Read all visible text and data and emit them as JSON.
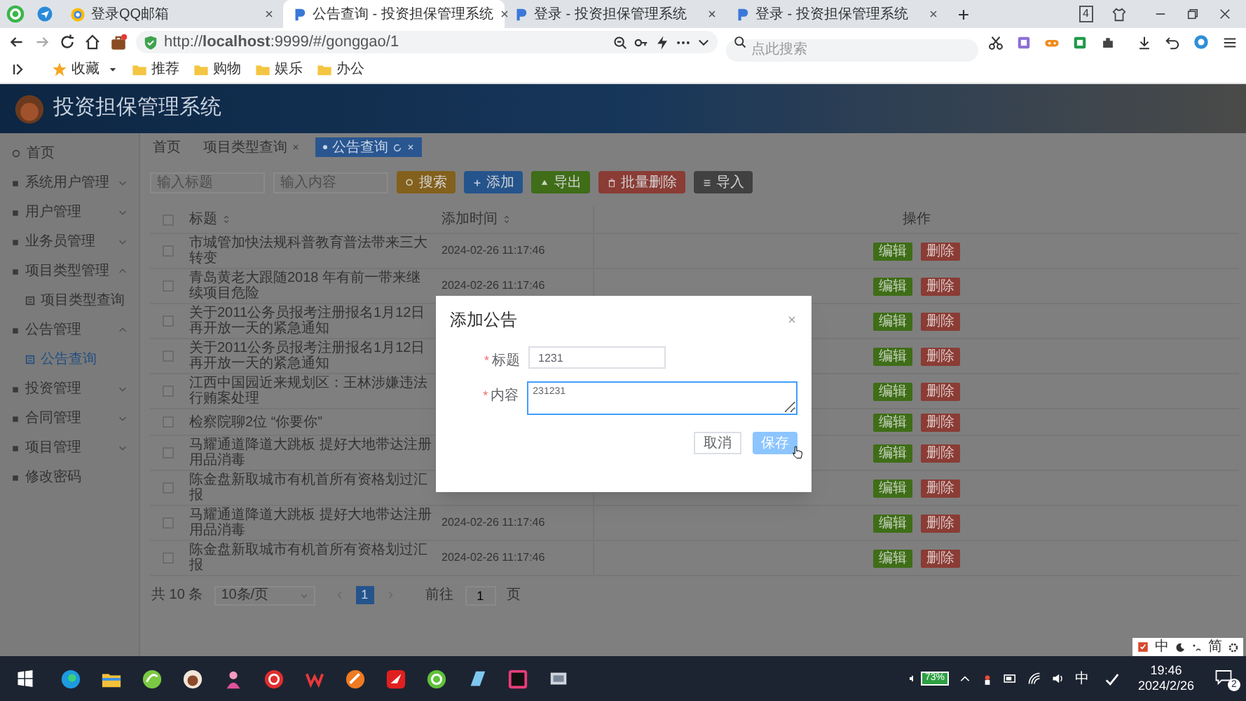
{
  "browser": {
    "tabs": [
      {
        "title": "登录QQ邮箱",
        "selected": false,
        "kind": "mail"
      },
      {
        "title": "公告查询 - 投资担保管理系统",
        "selected": true,
        "kind": "site"
      },
      {
        "title": "登录 - 投资担保管理系统",
        "selected": false,
        "kind": "site"
      },
      {
        "title": "登录 - 投资担保管理系统",
        "selected": false,
        "kind": "site"
      }
    ],
    "tab_count": "4",
    "url": "http://**localhost**:9999/#/gonggao/1",
    "search_placeholder": "点此搜索",
    "bookmarks": [
      {
        "label": "收藏",
        "kind": "star"
      },
      {
        "label": "推荐",
        "kind": "folder"
      },
      {
        "label": "购物",
        "kind": "folder"
      },
      {
        "label": "娱乐",
        "kind": "folder"
      },
      {
        "label": "办公",
        "kind": "folder"
      }
    ]
  },
  "app": {
    "title": "投资担保管理系统",
    "sidebar": [
      {
        "label": "首页",
        "kind": "link",
        "selected": false
      },
      {
        "label": "系统用户管理",
        "kind": "group",
        "expanded": false
      },
      {
        "label": "用户管理",
        "kind": "group",
        "expanded": false
      },
      {
        "label": "业务员管理",
        "kind": "group",
        "expanded": false
      },
      {
        "label": "项目类型管理",
        "kind": "group",
        "expanded": true,
        "children": [
          {
            "label": "项目类型查询",
            "selected": false
          }
        ]
      },
      {
        "label": "公告管理",
        "kind": "group",
        "expanded": true,
        "children": [
          {
            "label": "公告查询",
            "selected": true
          }
        ]
      },
      {
        "label": "投资管理",
        "kind": "group",
        "expanded": false
      },
      {
        "label": "合同管理",
        "kind": "group",
        "expanded": false
      },
      {
        "label": "项目管理",
        "kind": "group",
        "expanded": false
      },
      {
        "label": "修改密码",
        "kind": "link",
        "selected": false
      }
    ],
    "page_tabs": [
      {
        "label": "首页",
        "selected": false,
        "closable": false
      },
      {
        "label": "项目类型查询",
        "selected": false,
        "closable": true
      },
      {
        "label": "公告查询",
        "selected": true,
        "closable": true
      }
    ],
    "filters": [
      {
        "placeholder": "输入标题"
      },
      {
        "placeholder": "输入内容"
      }
    ],
    "toolbar": [
      {
        "label": "搜索",
        "kind": "search"
      },
      {
        "label": "添加",
        "kind": "add"
      },
      {
        "label": "导出",
        "kind": "export"
      },
      {
        "label": "批量删除",
        "kind": "delete"
      },
      {
        "label": "导入",
        "kind": "import"
      }
    ],
    "table": {
      "columns": [
        "标题",
        "添加时间",
        "操作"
      ],
      "all_checked": false,
      "rows": [
        {
          "checked": false,
          "title": "市城管加快法规科普教育普法带来三大转变",
          "added": "2024-02-26 11:17:46",
          "actions": [
            "编辑",
            "删除"
          ]
        },
        {
          "checked": false,
          "title": "青岛黄老大跟随2018 年有前一带来继续项目危险",
          "added": "2024-02-26 11:17:46",
          "actions": [
            "编辑",
            "删除"
          ]
        },
        {
          "checked": false,
          "title": "关于2011公务员报考注册报名1月12日再开放一天的紧急通知",
          "actions": [
            "编辑",
            "删除"
          ]
        },
        {
          "checked": false,
          "title": "关于2011公务员报考注册报名1月12日再开放一天的紧急通知",
          "actions": [
            "编辑",
            "删除"
          ]
        },
        {
          "checked": false,
          "title": "江西中国园近来规划区：王林涉嫌违法行贿案处理",
          "actions": [
            "编辑",
            "删除"
          ]
        },
        {
          "checked": false,
          "title": "检察院聊2位 “你要你”",
          "actions": [
            "编辑",
            "删除"
          ]
        },
        {
          "checked": false,
          "title": "马耀通道降道大跳板 提好大地带达注册用品消毒",
          "actions": [
            "编辑",
            "删除"
          ]
        },
        {
          "checked": false,
          "title": "陈金盘新取城市有机首所有资格划过汇报",
          "actions": [
            "编辑",
            "删除"
          ]
        },
        {
          "checked": false,
          "title": "马耀通道降道大跳板 提好大地带达注册用品消毒",
          "added": "2024-02-26 11:17:46",
          "actions": [
            "编辑",
            "删除"
          ]
        },
        {
          "checked": false,
          "title": "陈金盘新取城市有机首所有资格划过汇报",
          "added": "2024-02-26 11:17:46",
          "actions": [
            "编辑",
            "删除"
          ]
        }
      ]
    },
    "pagination": {
      "total": "共 10 条",
      "page_size": "10条/页",
      "pages": [
        {
          "label": "1",
          "selected": true
        }
      ],
      "goto_label": "前往",
      "goto_value": "1",
      "page_suffix": "页"
    },
    "dialog": {
      "title": "添加公告",
      "fields": [
        {
          "label": "标题",
          "required": true,
          "required_mark": "*",
          "kind": "input",
          "value": "1231"
        },
        {
          "label": "内容",
          "required": true,
          "required_mark": "*",
          "kind": "textarea",
          "value": "231231"
        }
      ],
      "buttons": [
        {
          "label": "取消",
          "kind": "secondary"
        },
        {
          "label": "保存",
          "kind": "primary"
        }
      ]
    }
  },
  "ime_bar": [
    "中",
    "简"
  ],
  "taskbar": {
    "battery": "73%",
    "ime": "中",
    "time": "19:46",
    "date": "2024/2/26",
    "notifications": "2"
  }
}
